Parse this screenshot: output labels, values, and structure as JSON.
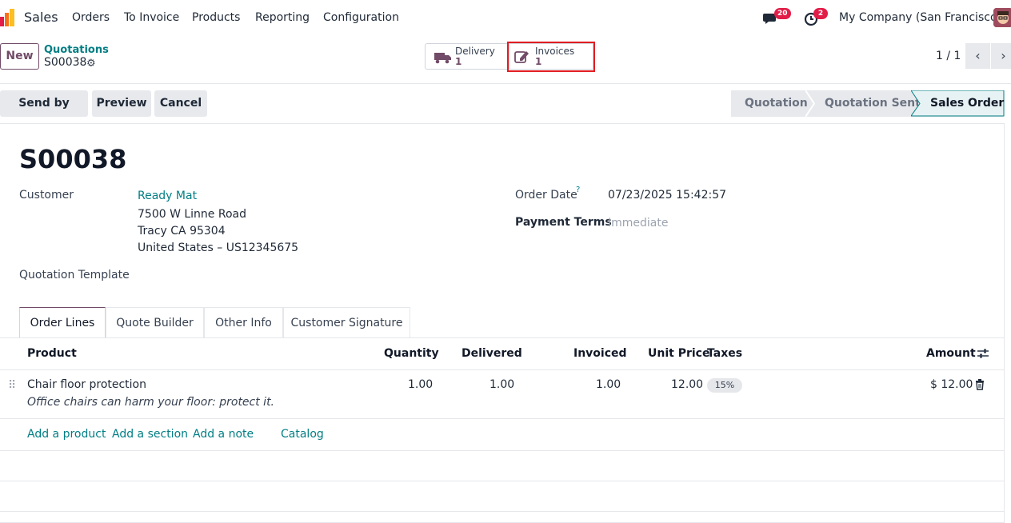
{
  "nav": {
    "app": "Sales",
    "menu": [
      "Orders",
      "To Invoice",
      "Products",
      "Reporting",
      "Configuration"
    ],
    "messages_count": "20",
    "activities_count": "2",
    "company": "My Company (San Francisco)"
  },
  "control": {
    "new_label": "New",
    "breadcrumb_parent": "Quotations",
    "breadcrumb_current": "S00038",
    "smart_buttons": [
      {
        "label": "Delivery",
        "value": "1",
        "icon": "truck-icon"
      },
      {
        "label": "Invoices",
        "value": "1",
        "icon": "pencil-square-icon"
      }
    ],
    "pager": "1 / 1"
  },
  "actions": {
    "buttons": [
      "Send by Email",
      "Preview",
      "Cancel"
    ],
    "statuses": [
      "Quotation",
      "Quotation Sent",
      "Sales Order"
    ],
    "active_status": "Sales Order"
  },
  "form": {
    "title": "S00038",
    "customer_label": "Customer",
    "customer_name": "Ready Mat",
    "address_line1": "7500 W Linne Road",
    "address_line2": "Tracy CA 95304",
    "address_line3": "United States – US12345675",
    "template_label": "Quotation Template",
    "order_date_label": "Order Date",
    "order_date_help": "?",
    "order_date": "07/23/2025 15:42:57",
    "payment_terms_label": "Payment Terms",
    "payment_terms": "Immediate"
  },
  "tabs": [
    "Order Lines",
    "Quote Builder",
    "Other Info",
    "Customer Signature"
  ],
  "table": {
    "headers": {
      "product": "Product",
      "quantity": "Quantity",
      "delivered": "Delivered",
      "invoiced": "Invoiced",
      "unit_price": "Unit Price",
      "taxes": "Taxes",
      "amount": "Amount"
    },
    "rows": [
      {
        "product": "Chair floor protection",
        "description": "Office chairs can harm your floor: protect it.",
        "quantity": "1.00",
        "delivered": "1.00",
        "invoiced": "1.00",
        "unit_price": "12.00",
        "tax": "15%",
        "amount": "$ 12.00"
      }
    ],
    "add_links": [
      "Add a product",
      "Add a section",
      "Add a note",
      "Catalog"
    ]
  },
  "colors": {
    "brand": "#714b67",
    "link": "#017e84",
    "highlight": "#e11d22"
  }
}
